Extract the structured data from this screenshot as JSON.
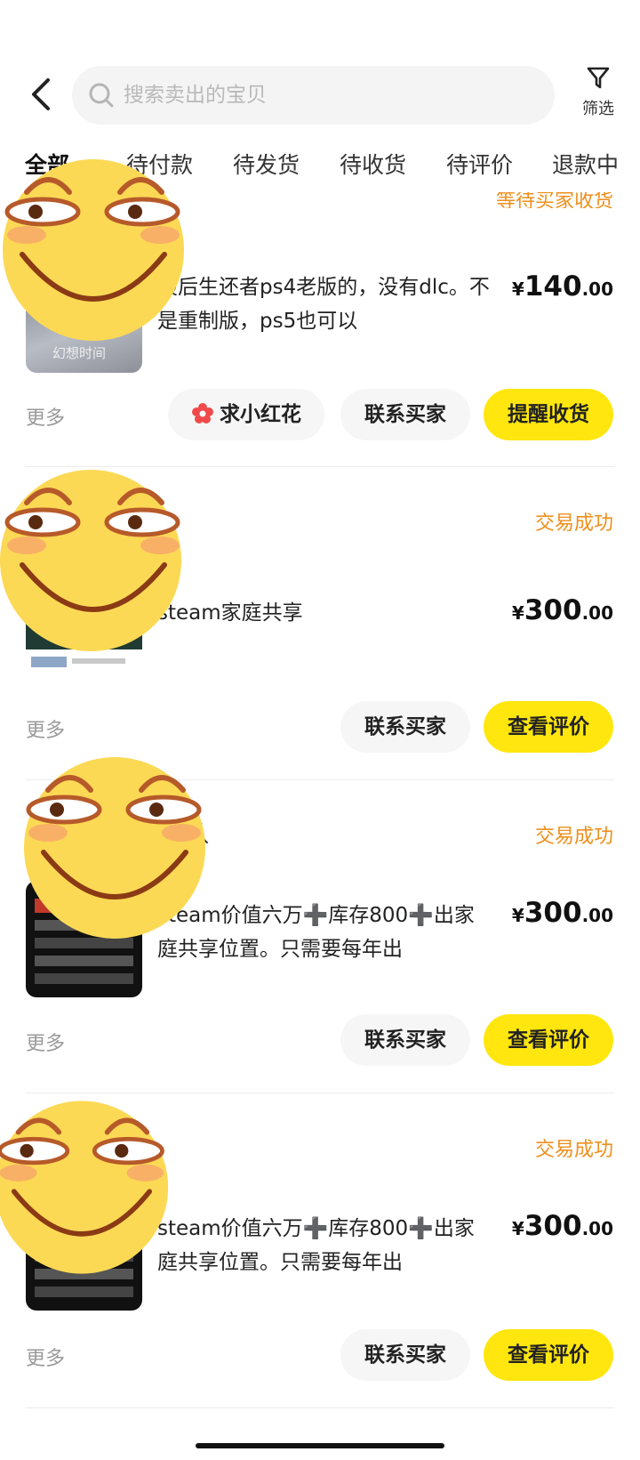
{
  "header": {
    "search_placeholder": "搜索卖出的宝贝",
    "filter_label": "筛选"
  },
  "tabs": [
    {
      "label": "全部"
    },
    {
      "label": "待付款"
    },
    {
      "label": "待发货"
    },
    {
      "label": "待收货"
    },
    {
      "label": "待评价"
    },
    {
      "label": "退款中"
    }
  ],
  "orders": [
    {
      "status": "等待买家收货",
      "desc": "最后生还者ps4老版的，没有dlc。不是重制版，ps5也可以",
      "thumb_caption": "幻想时间",
      "price": {
        "currency": "¥",
        "integer": "140",
        "decimal": ".00"
      },
      "more": "更多",
      "buttons": [
        "求小红花",
        "联系买家",
        "提醒收货"
      ]
    },
    {
      "status": "交易成功",
      "desc": "steam家庭共享",
      "price": {
        "currency": "¥",
        "integer": "300",
        "decimal": ".00"
      },
      "more": "更多",
      "buttons": [
        "联系买家",
        "查看评价"
      ]
    },
    {
      "status": "交易成功",
      "title_fragment": "队",
      "desc": "steam价值六万➕库存800➕出家庭共享位置。只需要每年出",
      "price": {
        "currency": "¥",
        "integer": "300",
        "decimal": ".00"
      },
      "more": "更多",
      "buttons": [
        "联系买家",
        "查看评价"
      ]
    },
    {
      "status": "交易成功",
      "desc": "steam价值六万➕库存800➕出家庭共享位置。只需要每年出",
      "price": {
        "currency": "¥",
        "integer": "300",
        "decimal": ".00"
      },
      "more": "更多",
      "buttons": [
        "联系买家",
        "查看评价"
      ]
    }
  ],
  "colors": {
    "accent_yellow": "#ffe60f",
    "status_orange": "#ee8f1c",
    "flower_red": "#f04a4a"
  },
  "icons": [
    "back-arrow-icon",
    "search-icon",
    "filter-icon",
    "flower-icon",
    "emoji-sticker"
  ]
}
